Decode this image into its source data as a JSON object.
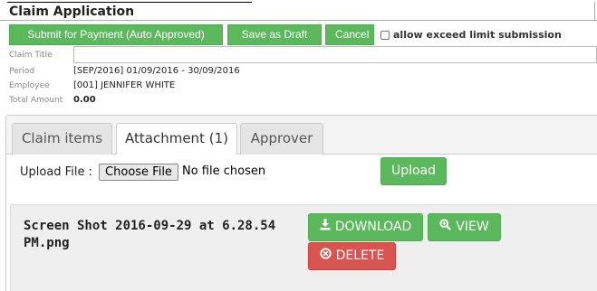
{
  "header": {
    "title": "Claim Application"
  },
  "toolbar": {
    "submit_label": "Submit for Payment (Auto Approved)",
    "draft_label": "Save as Draft",
    "cancel_label": "Cancel",
    "allow_exceed_label": "allow exceed limit submission",
    "allow_exceed_checked": false
  },
  "form": {
    "claim_title_label": "Claim Title",
    "claim_title_value": "",
    "period_label": "Period",
    "period_value": "[SEP/2016] 01/09/2016 - 30/09/2016",
    "employee_label": "Employee",
    "employee_value": "[001] JENNIFER WHITE",
    "total_label": "Total Amount",
    "total_value": "0.00"
  },
  "tabs": [
    {
      "label": "Claim items",
      "active": false
    },
    {
      "label": "Attachment (1)",
      "active": true
    },
    {
      "label": "Approver",
      "active": false
    }
  ],
  "upload": {
    "label": "Upload File :",
    "choose_label": "Choose File",
    "status": "No file chosen",
    "upload_label": "Upload"
  },
  "attachment": {
    "file_name": "Screen Shot 2016-09-29 at 6.28.54 PM.png",
    "download_label": "DOWNLOAD",
    "download_icon": "download-icon",
    "view_label": "VIEW",
    "view_icon": "search-icon",
    "delete_label": "DELETE",
    "delete_icon": "times-circle-icon"
  },
  "colors": {
    "success": "#5cb85c",
    "danger": "#d9534f"
  }
}
